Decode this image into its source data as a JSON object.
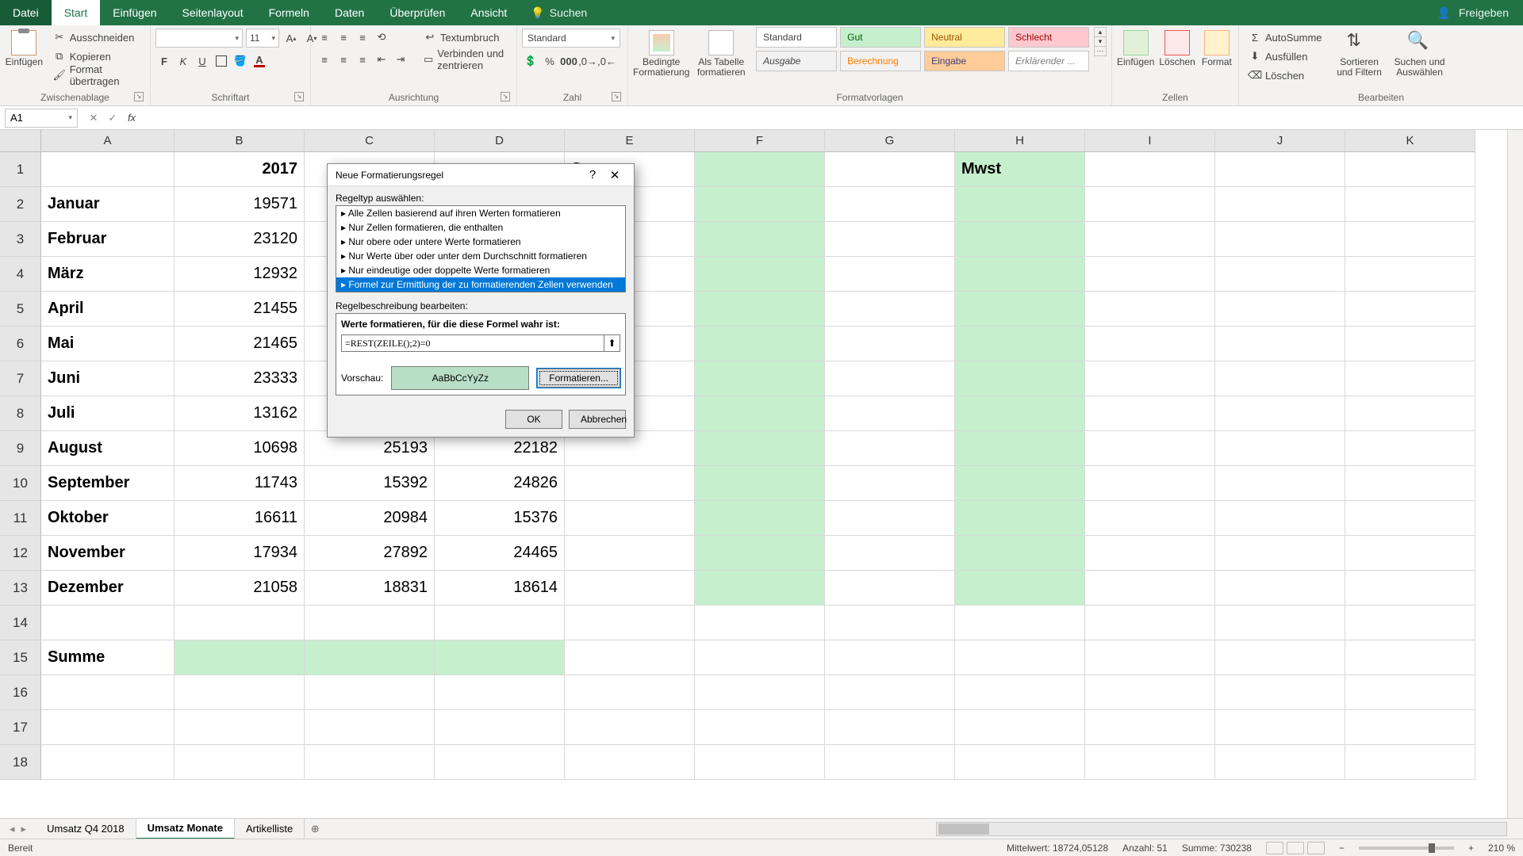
{
  "titlebar": {
    "tabs": {
      "file": "Datei",
      "start": "Start",
      "insert": "Einfügen",
      "page": "Seitenlayout",
      "formulas": "Formeln",
      "data": "Daten",
      "review": "Überprüfen",
      "view": "Ansicht"
    },
    "search": "Suchen",
    "share": "Freigeben"
  },
  "ribbon": {
    "clipboard": {
      "label": "Zwischenablage",
      "paste": "Einfügen",
      "cut": "Ausschneiden",
      "copy": "Kopieren",
      "formatpainter": "Format übertragen"
    },
    "font": {
      "label": "Schriftart",
      "fontname": "",
      "fontsize": "11",
      "bold": "F",
      "italic": "K",
      "underline": "U"
    },
    "align": {
      "label": "Ausrichtung",
      "wrap": "Textumbruch",
      "merge": "Verbinden und zentrieren"
    },
    "number": {
      "label": "Zahl",
      "format": "Standard"
    },
    "styles": {
      "label": "Formatvorlagen",
      "cond": "Bedingte Formatierung",
      "table": "Als Tabelle formatieren",
      "swatches": {
        "standard": "Standard",
        "gut": "Gut",
        "neutral": "Neutral",
        "schlecht": "Schlecht",
        "ausgabe": "Ausgabe",
        "berechnung": "Berechnung",
        "eingabe": "Eingabe",
        "erklaerend": "Erklärender ..."
      }
    },
    "cells": {
      "label": "Zellen",
      "insert": "Einfügen",
      "delete": "Löschen",
      "format": "Format"
    },
    "editing": {
      "label": "Bearbeiten",
      "autosum": "AutoSumme",
      "fill": "Ausfüllen",
      "clear": "Löschen",
      "sort": "Sortieren und Filtern",
      "find": "Suchen und Auswählen"
    }
  },
  "namebox": "A1",
  "columns": [
    "A",
    "B",
    "C",
    "D",
    "E",
    "F",
    "G",
    "H",
    "I",
    "J",
    "K"
  ],
  "headers": {
    "b": "2017",
    "e": "Summe",
    "h": "Mwst"
  },
  "rows": [
    {
      "a": "Januar",
      "b": "19571"
    },
    {
      "a": "Februar",
      "b": "23120"
    },
    {
      "a": "März",
      "b": "12932"
    },
    {
      "a": "April",
      "b": "21455"
    },
    {
      "a": "Mai",
      "b": "21465"
    },
    {
      "a": "Juni",
      "b": "23333"
    },
    {
      "a": "Juli",
      "b": "13162"
    },
    {
      "a": "August",
      "b": "10698",
      "c": "25193",
      "d": "22182"
    },
    {
      "a": "September",
      "b": "11743",
      "c": "15392",
      "d": "24826"
    },
    {
      "a": "Oktober",
      "b": "16611",
      "c": "20984",
      "d": "15376"
    },
    {
      "a": "November",
      "b": "17934",
      "c": "27892",
      "d": "24465"
    },
    {
      "a": "Dezember",
      "b": "21058",
      "c": "18831",
      "d": "18614"
    }
  ],
  "summe_label": "Summe",
  "sheets": {
    "s1": "Umsatz Q4 2018",
    "s2": "Umsatz Monate",
    "s3": "Artikelliste"
  },
  "status": {
    "ready": "Bereit",
    "avg_label": "Mittelwert:",
    "avg": "18724,05128",
    "count_label": "Anzahl:",
    "count": "51",
    "sum_label": "Summe:",
    "sum": "730238",
    "zoom": "210 %"
  },
  "dialog": {
    "title": "Neue Formatierungsregel",
    "ruletype_label": "Regeltyp auswählen:",
    "rules": [
      "Alle Zellen basierend auf ihren Werten formatieren",
      "Nur Zellen formatieren, die enthalten",
      "Nur obere oder untere Werte formatieren",
      "Nur Werte über oder unter dem Durchschnitt formatieren",
      "Nur eindeutige oder doppelte Werte formatieren",
      "Formel zur Ermittlung der zu formatierenden Zellen verwenden"
    ],
    "desc_label": "Regelbeschreibung bearbeiten:",
    "formula_header": "Werte formatieren, für die diese Formel wahr ist:",
    "formula": "=REST(ZEILE();2)=0",
    "preview_label": "Vorschau:",
    "preview_text": "AaBbCcYyZz",
    "format_btn": "Formatieren...",
    "ok": "OK",
    "cancel": "Abbrechen"
  }
}
